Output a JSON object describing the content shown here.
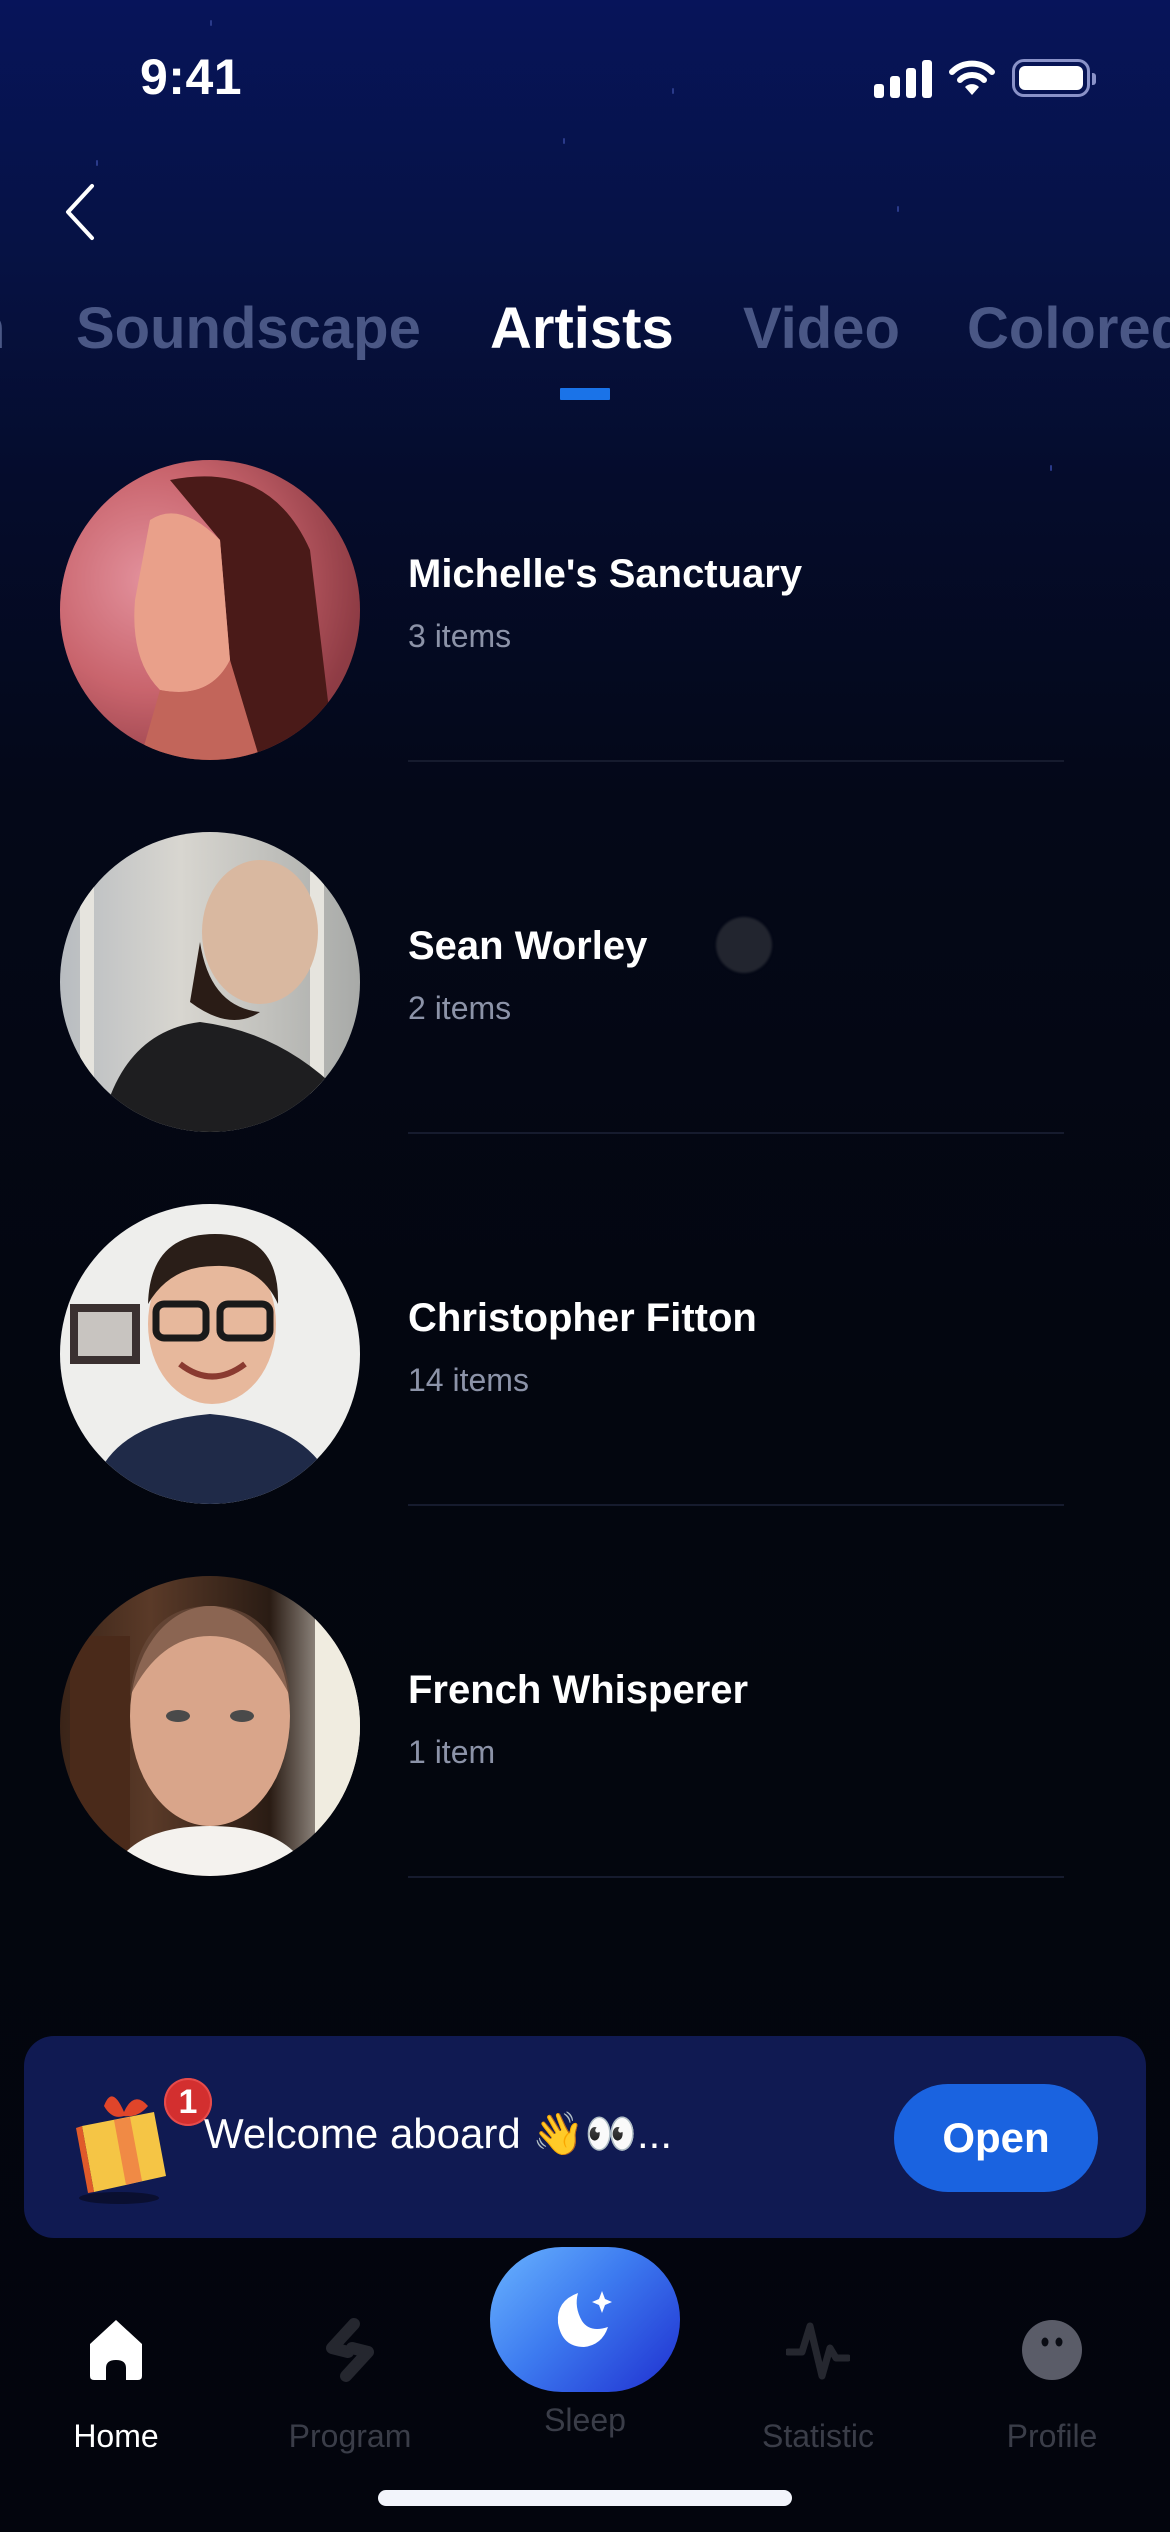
{
  "status_bar": {
    "time": "9:41",
    "icons": [
      "cellular-signal-icon",
      "wifi-icon",
      "battery-icon"
    ]
  },
  "header": {
    "back_icon": "chevron-left-icon"
  },
  "tabs": {
    "items": [
      {
        "label": "Meditation",
        "visible_fragment": "n",
        "active": false
      },
      {
        "label": "Soundscape",
        "active": false
      },
      {
        "label": "Artists",
        "active": true
      },
      {
        "label": "Video",
        "active": false
      },
      {
        "label": "Colored",
        "active": false
      }
    ],
    "active_color": "#ffffff",
    "inactive_color": "#4a5785",
    "indicator_color": "#1a73e8"
  },
  "artists": [
    {
      "name": "Michelle's Sanctuary",
      "count": "3 items",
      "avatar": "woman-with-brown-hair-photo"
    },
    {
      "name": "Sean Worley",
      "count": "2 items",
      "avatar": "bearded-man-profile-photo"
    },
    {
      "name": "Christopher Fitton",
      "count": "14 items",
      "avatar": "man-with-glasses-photo"
    },
    {
      "name": "French Whisperer",
      "count": "1 item",
      "avatar": "man-with-bookshelf-photo"
    }
  ],
  "banner": {
    "icon": "gift-icon",
    "badge_count": "1",
    "text": "Welcome aboard 👋👀...",
    "button_label": "Open",
    "button_color": "#1a63e0",
    "background_color": "#101a52"
  },
  "bottom_nav": {
    "items": [
      {
        "label": "Home",
        "icon": "home-icon",
        "active": true
      },
      {
        "label": "Program",
        "icon": "program-icon",
        "active": false
      },
      {
        "label": "Sleep",
        "icon": "moon-star-icon",
        "active": false
      },
      {
        "label": "Statistic",
        "icon": "pulse-icon",
        "active": false
      },
      {
        "label": "Profile",
        "icon": "face-icon",
        "active": false
      }
    ]
  }
}
